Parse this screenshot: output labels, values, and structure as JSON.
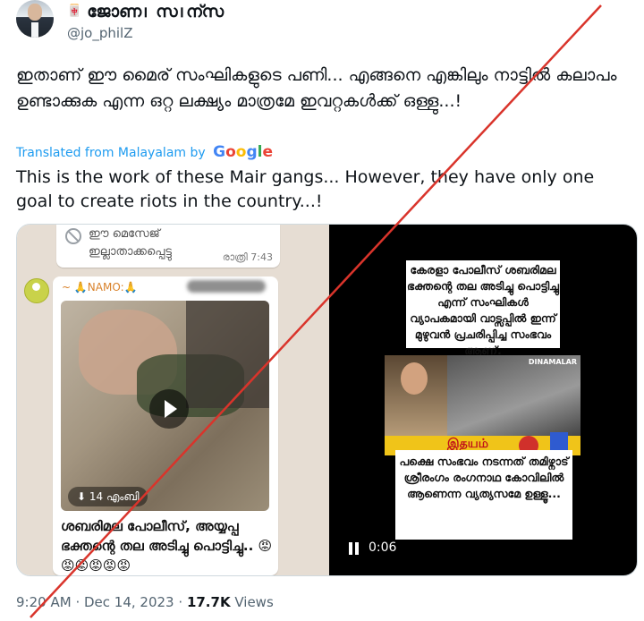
{
  "header": {
    "name": "ജോണ। സ।ന്സ",
    "handle": "@jo_philZ"
  },
  "tweet": {
    "text_malayalam": "ഇതാണ് ഈ മൈര് സംഘികളുടെ പണി... എങ്ങനെ എങ്കിലും നാട്ടിൽ കലാപം ഉണ്ടാക്കുക എന്ന ഒറ്റ ലക്ഷ്യം മാത്രമേ ഇവറ്റകൾക്ക് ഒള്ളു...!",
    "translated_label": "Translated from Malayalam by",
    "translator": "Google",
    "text_english": "This is the work of these Mair gangs... However, they have only one goal to create riots in the country...!"
  },
  "chat": {
    "deleted_message": "ഈ മെസേജ് ഇല്ലാതാക്കപ്പെട്ടു",
    "deleted_time": "രാത്രി 7:43",
    "sender_name": "~ 🙏NAMO:🙏",
    "video_size": "⬇  14 എംബി",
    "caption": "ശബരിമല പോലീസ്, അയ്യപ്പ ഭക്തന്റെ തല അടിച്ചു പൊട്ടിച്ചു.. 😡😡😡😡😡😡"
  },
  "video": {
    "caption_top": "കേരളാ പോലീസ് ശബരിമല ഭക്തന്റെ തല അടിച്ചു പൊട്ടിച്ചു എന്ന് സംഘികൾ വ്യാപകമായി വാട്സപ്പിൽ ഇന്ന് മുഴുവൻ പ്രചരിപ്പിച്ച സംഭവം ആണ്.",
    "news_logo": "DINAMALAR",
    "news_band": "இதயம்",
    "caption_bottom": "പക്ഷെ സംഭവം നടന്നത് തമിഴ്നാട് ശ്രീരംഗം രംഗനാഥ കോവിലിൽ ആണെന്ന വ്യത്യസമേ ഉള്ളൂ...",
    "time": "0:06"
  },
  "meta": {
    "time": "9:20 AM",
    "separator": "·",
    "date": "Dec 14, 2023",
    "views_count": "17.7K",
    "views_label": "Views"
  },
  "colors": {
    "link_blue": "#1d9bf0",
    "strike_red": "#d9342b",
    "secondary_text": "#536471"
  }
}
